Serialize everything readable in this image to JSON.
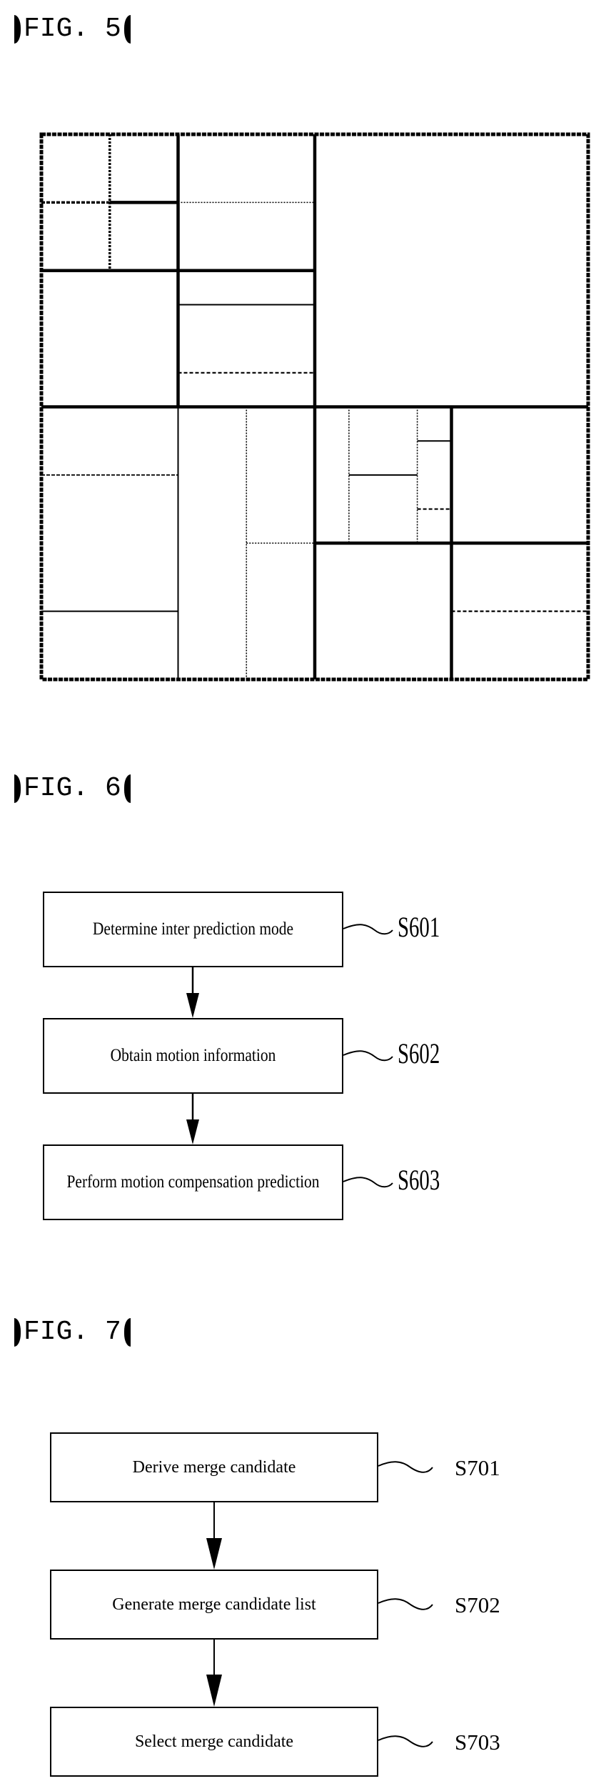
{
  "figures": [
    {
      "id": "fig5",
      "label": "FIG. 5",
      "caption_open": "【",
      "caption_close": "】",
      "description": "Block partitioning of a coding tree unit",
      "grid_units": 16,
      "line_styles": {
        "thick": "quad-tree split",
        "thin": "binary split (solid)",
        "dashed": "binary split (dashed)",
        "dotted": "binary split (dotted)"
      },
      "partition_lines": [
        {
          "orient": "h",
          "at": 8,
          "from": 0,
          "to": 16,
          "style": "thick"
        },
        {
          "orient": "v",
          "at": 8,
          "from": 0,
          "to": 16,
          "style": "thick"
        },
        {
          "orient": "v",
          "at": 4,
          "from": 0,
          "to": 8,
          "style": "thick"
        },
        {
          "orient": "h",
          "at": 4,
          "from": 0,
          "to": 8,
          "style": "thick"
        },
        {
          "orient": "v",
          "at": 2,
          "from": 0,
          "to": 4,
          "style": "thick-dotted"
        },
        {
          "orient": "h",
          "at": 2,
          "from": 0,
          "to": 2,
          "style": "thick-dashed"
        },
        {
          "orient": "h",
          "at": 2,
          "from": 2,
          "to": 4,
          "style": "thick"
        },
        {
          "orient": "h",
          "at": 2,
          "from": 4,
          "to": 8,
          "style": "dotted"
        },
        {
          "orient": "h",
          "at": 5,
          "from": 4,
          "to": 8,
          "style": "thin"
        },
        {
          "orient": "h",
          "at": 7,
          "from": 4,
          "to": 8,
          "style": "dashed"
        },
        {
          "orient": "v",
          "at": 4,
          "from": 8,
          "to": 16,
          "style": "thin"
        },
        {
          "orient": "v",
          "at": 6,
          "from": 8,
          "to": 16,
          "style": "dotted"
        },
        {
          "orient": "h",
          "at": 10,
          "from": 0,
          "to": 4,
          "style": "dashed-thin"
        },
        {
          "orient": "h",
          "at": 14,
          "from": 0,
          "to": 4,
          "style": "thin"
        },
        {
          "orient": "h",
          "at": 12,
          "from": 6,
          "to": 8,
          "style": "dotted"
        },
        {
          "orient": "h",
          "at": 12,
          "from": 8,
          "to": 16,
          "style": "thick"
        },
        {
          "orient": "v",
          "at": 12,
          "from": 8,
          "to": 16,
          "style": "thick"
        },
        {
          "orient": "v",
          "at": 9,
          "from": 8,
          "to": 12,
          "style": "dotted"
        },
        {
          "orient": "v",
          "at": 11,
          "from": 8,
          "to": 12,
          "style": "dotted"
        },
        {
          "orient": "h",
          "at": 10,
          "from": 9,
          "to": 11,
          "style": "thin"
        },
        {
          "orient": "h",
          "at": 9,
          "from": 11,
          "to": 12,
          "style": "thin"
        },
        {
          "orient": "h",
          "at": 11,
          "from": 11,
          "to": 12,
          "style": "dashed"
        },
        {
          "orient": "h",
          "at": 14,
          "from": 12,
          "to": 16,
          "style": "dashed"
        }
      ]
    },
    {
      "id": "fig6",
      "label": "FIG. 6",
      "caption_open": "【",
      "caption_close": "】",
      "steps": [
        {
          "text": "Determine inter prediction mode",
          "ref": "S601"
        },
        {
          "text": "Obtain motion information",
          "ref": "S602"
        },
        {
          "text": "Perform motion compensation prediction",
          "ref": "S603"
        }
      ]
    },
    {
      "id": "fig7",
      "label": "FIG. 7",
      "caption_open": "【",
      "caption_close": "】",
      "steps": [
        {
          "text": "Derive merge candidate",
          "ref": "S701"
        },
        {
          "text": "Generate merge candidate list",
          "ref": "S702"
        },
        {
          "text": "Select merge candidate",
          "ref": "S703"
        }
      ]
    }
  ]
}
